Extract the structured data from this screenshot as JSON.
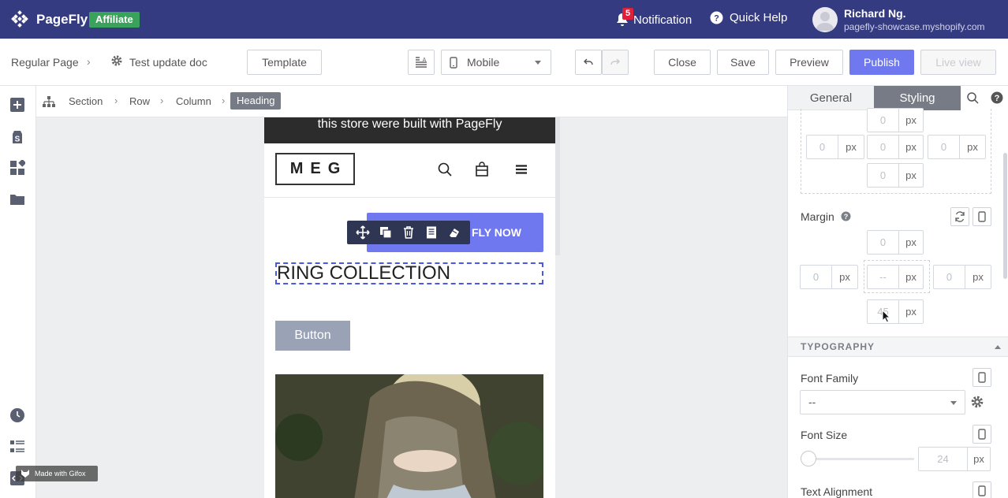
{
  "app": {
    "name": "PageFly",
    "affiliate_badge": "Affiliate"
  },
  "header": {
    "notification_label": "Notification",
    "notification_count": "5",
    "quick_help_label": "Quick Help",
    "user_name": "Richard Ng.",
    "user_shop": "pagefly-showcase.myshopify.com"
  },
  "toolbar": {
    "page_type": "Regular Page",
    "page_name": "Test update doc",
    "template_label": "Template",
    "device_label": "Mobile",
    "close_label": "Close",
    "save_label": "Save",
    "preview_label": "Preview",
    "publish_label": "Publish",
    "live_view_label": "Live view"
  },
  "breadcrumb": [
    "Section",
    "Row",
    "Column",
    "Heading"
  ],
  "canvas": {
    "promo_text": "this store were built with PageFly",
    "brand": "MEG",
    "cta_label": "FLY NOW",
    "heading_text": "RING COLLECTION",
    "sample_button": "Button"
  },
  "panel": {
    "tabs": {
      "general": "General",
      "styling": "Styling"
    },
    "padding_values": {
      "top": "0",
      "left": "0",
      "center": "0",
      "right": "0",
      "bottom": "0"
    },
    "unit": "px",
    "margin_label": "Margin",
    "margin_values": {
      "top": "0",
      "left": "0",
      "center": "--",
      "right": "0",
      "bottom": "45"
    },
    "typography_title": "TYPOGRAPHY",
    "font_family_label": "Font Family",
    "font_family_value": "--",
    "font_size_label": "Font Size",
    "font_size_value": "24",
    "text_alignment_label": "Text Alignment"
  },
  "watermark": "Made with Gifox",
  "colors": {
    "topbar": "#343b80",
    "affiliate_green": "#3aa35b",
    "primary": "#6f78ee",
    "selection": "#4b57e6",
    "notification_red": "#e0203a"
  }
}
